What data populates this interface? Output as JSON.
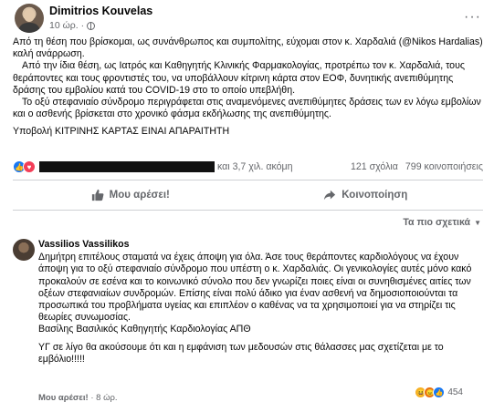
{
  "post": {
    "author": "Dimitrios Kouvelas",
    "time": "10 ώρ. ·",
    "more_icon": "more-horizontal-icon",
    "paragraphs": [
      "Από τη θέση που βρίσκομαι, ως συνάνθρωπος και συμπολίτης, εύχομαι στον κ. Χαρδαλιά (@Nikos Hardalias) καλή ανάρρωση.",
      "Από την ίδια θέση, ως Ιατρός και Καθηγητής Κλινικής Φαρμακολογίας, προτρέπω τον κ. Χαρδαλιά, τους θεράποντες και τους φροντιστές του, να υποβάλλουν κίτρινη κάρτα στον ΕΟΦ, δυνητικής ανεπιθύμητης δράσης του εμβολίου κατά του COVID-19 στο το οποίο υπεβλήθη.",
      "Το οξύ στεφανιαίο σύνδρομο περιγράφεται στις αναμενόμενες ανεπιθύμητες δράσεις των εν λόγω εμβολίων και ο ασθενής βρίσκεται στο χρονικό φάσμα εκδήλωσης της ανεπιθύμητης.",
      "Υποβολή ΚΙΤΡΙΝΗΣ ΚΑΡΤΑΣ ΕΙΝΑΙ ΑΠΑΡΑΙΤΗΤΗ"
    ]
  },
  "reactions": {
    "others_text": "και 3,7 χιλ. ακόμη",
    "comments": "121 σχόλια",
    "shares": "799 κοινοποιήσεις"
  },
  "actions": {
    "like_label": "Μου αρέσει!",
    "share_label": "Κοινοποίηση"
  },
  "sort": {
    "label": "Τα πιο σχετικά"
  },
  "comment": {
    "author": "Vassilios Vassilikos",
    "paragraph1": "Δημήτρη επιτέλους σταματά να έχεις άποψη για όλα. Άσε τους θεράποντες καρδιολόγους να έχουν άποψη για το οξύ στεφανιαίο σύνδρομο που υπέστη ο κ. Χαρδαλιάς. Οι γενικολογίες αυτές μόνο κακό προκαλούν σε εσένα και το κοινωνικό σύνολο που δεν γνωρίζει ποιες είναι οι συνηθισμένες αιτίες των οξέων στεφανιαίων συνδρομών. Επίσης είναι πολύ άδικο για έναν ασθενή να δημοσιοποιούνται τα προσωπικά του προβλήματα υγείας και επιπλέον ο καθένας να τα χρησιμοποιεί για να στηρίζει τις θεωρίες συνωμοσίας.",
    "signature": "Βασίλης Βασιλικός Καθηγητής Καρδιολογίας ΑΠΘ",
    "paragraph2": "ΥΓ σε λίγο θα ακούσουμε ότι και η εμφάνιση των μεδουσών στις θάλασσες μας σχετίζεται με το εμβόλιο!!!!!",
    "like_label": "Μου αρέσει!",
    "time": "· 8 ώρ.",
    "reaction_count": "454"
  }
}
